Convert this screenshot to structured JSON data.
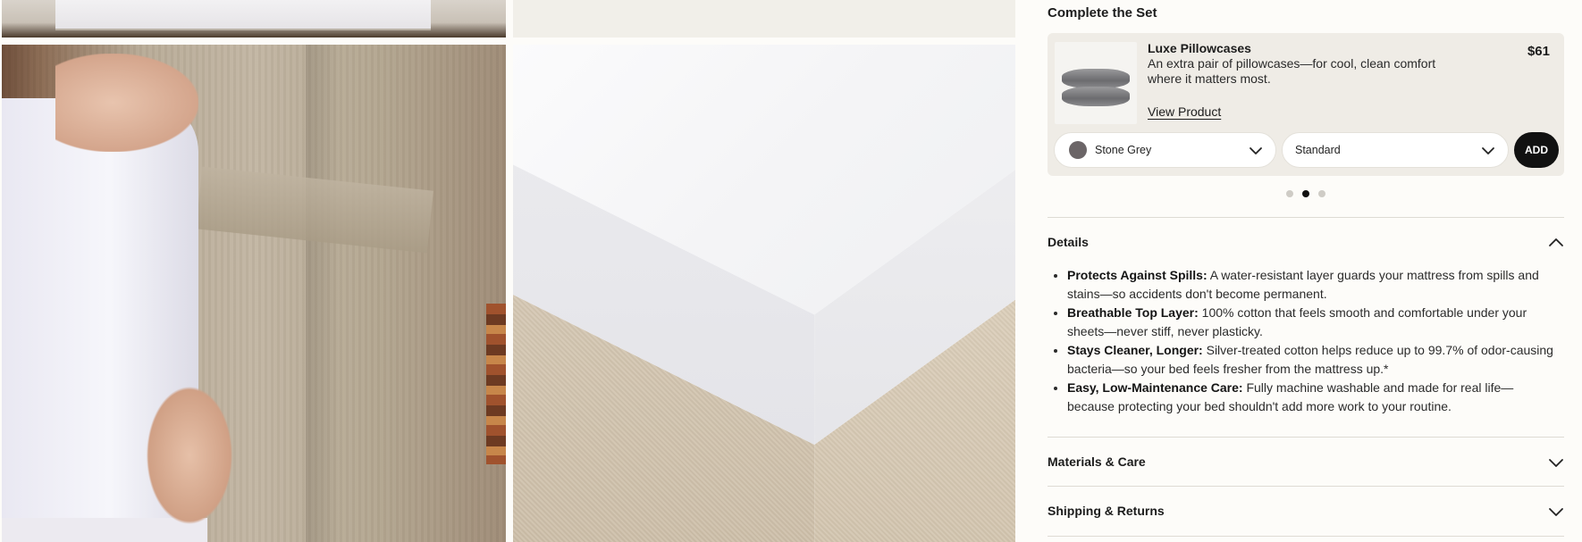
{
  "complete_set": {
    "title": "Complete the Set",
    "product": {
      "name": "Luxe Pillowcases",
      "description": "An extra pair of pillowcases—for cool, clean comfort where it matters most.",
      "price": "$61",
      "view_link": "View Product",
      "color_select": {
        "value": "Stone Grey",
        "swatch_color": "#6b6567"
      },
      "size_select": {
        "value": "Standard"
      },
      "add_label": "ADD",
      "thumbnail_icon": "pillow-icon"
    },
    "carousel": {
      "count": 3,
      "active_index": 1
    }
  },
  "accordion": {
    "details": {
      "title": "Details",
      "expanded": true,
      "items": [
        {
          "label": "Protects Against Spills:",
          "text": " A water-resistant layer guards your mattress from spills and stains—so accidents don't become permanent."
        },
        {
          "label": "Breathable Top Layer:",
          "text": " 100% cotton that feels smooth and comfortable under your sheets—never stiff, never plasticky."
        },
        {
          "label": "Stays Cleaner, Longer:",
          "text": " Silver-treated cotton helps reduce up to 99.7% of odor-causing bacteria—so your bed feels fresher from the mattress up.*"
        },
        {
          "label": "Easy, Low-Maintenance Care:",
          "text": " Fully machine washable and made for real life—because protecting your bed shouldn't add more work to your routine."
        }
      ]
    },
    "materials": {
      "title": "Materials & Care",
      "expanded": false
    },
    "shipping": {
      "title": "Shipping & Returns",
      "expanded": false
    }
  },
  "gallery": {
    "images": [
      {
        "alt_icon": "fitted-sheet-photo"
      },
      {
        "alt_icon": "product-photo-plain"
      },
      {
        "alt_icon": "person-fitting-mattress-protector-photo"
      },
      {
        "alt_icon": "mattress-protector-corner-photo"
      }
    ]
  },
  "colors": {
    "accent": "#111111",
    "card_bg": "#efece6",
    "page_bg": "#fdfcf9"
  }
}
